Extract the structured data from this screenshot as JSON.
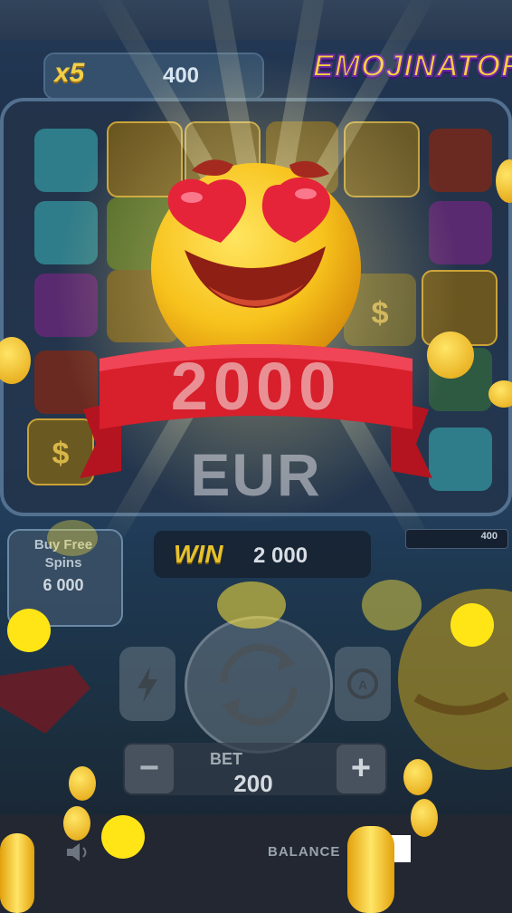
{
  "header": {
    "multiplier": "x5",
    "multiplier_value": "400",
    "logo_text": "EMOJINATOR"
  },
  "big_win": {
    "amount": "2000",
    "currency": "EUR"
  },
  "buy_free_spins": {
    "label": "Buy Free\nSpins",
    "price": "6 000"
  },
  "win_panel": {
    "label": "WIN",
    "value": "2 000"
  },
  "side_info": {
    "value": "400"
  },
  "bet": {
    "label": "BET",
    "value": "200",
    "minus": "−",
    "plus": "+"
  },
  "footer": {
    "balance_label": "BALANCE"
  },
  "icons": [
    "sound-icon",
    "turbo-bolt-icon",
    "spin-arrows-icon",
    "autoplay-icon",
    "heart-eyes-emoji",
    "red-ribbon",
    "gold-coin",
    "red-gem"
  ],
  "colors": {
    "accent_gold": "#f1cf4a",
    "ribbon_red": "#d81f2c",
    "emoji_yellow": "#f7c21c"
  }
}
